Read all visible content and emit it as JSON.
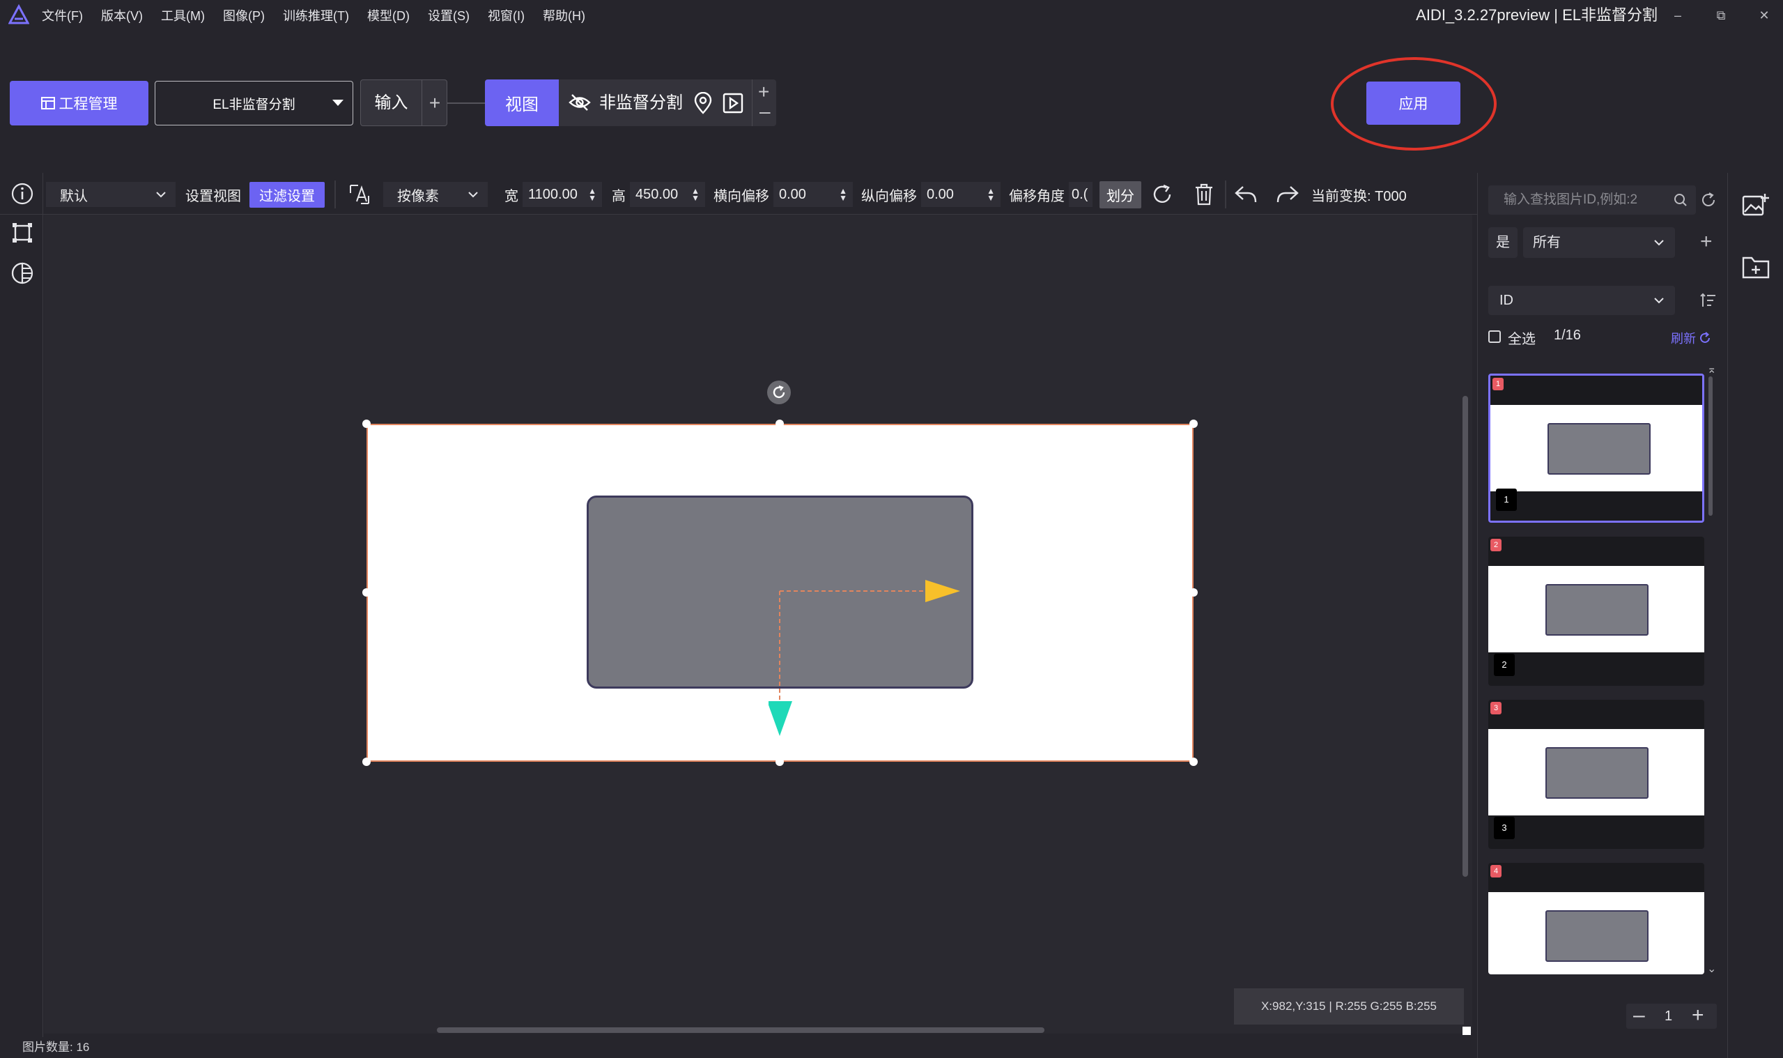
{
  "menu": [
    "文件(F)",
    "版本(V)",
    "工具(M)",
    "图像(P)",
    "训练推理(T)",
    "模型(D)",
    "设置(S)",
    "视窗(I)",
    "帮助(H)"
  ],
  "app_title": "AIDI_3.2.27preview | EL非监督分割",
  "window_controls": {
    "minimize": "–",
    "restore": "⧉",
    "close": "✕"
  },
  "toolbar": {
    "project_mgmt": "工程管理",
    "project_select": "EL非监督分割",
    "input": "输入",
    "add": "+",
    "view": "视图",
    "module": "非监督分割",
    "apply": "应用"
  },
  "view_toolbar": {
    "view_select": "默认",
    "set_view": "设置视图",
    "filter_settings": "过滤设置",
    "unit_select": "按像素",
    "width_label": "宽",
    "width_value": "1100.00",
    "height_label": "高",
    "height_value": "450.00",
    "h_offset_label": "横向偏移",
    "h_offset_value": "0.00",
    "v_offset_label": "纵向偏移",
    "v_offset_value": "0.00",
    "angle_label": "偏移角度",
    "angle_value": "0.(",
    "split": "划分",
    "current_transform": "当前变换: T000"
  },
  "right_panel": {
    "search_placeholder": "输入查找图片ID,例如:2",
    "filter_yes": "是",
    "filter_all": "所有",
    "sort_field": "ID",
    "select_all": "全选",
    "count": "1/16",
    "refresh": "刷新",
    "thumbnails": [
      {
        "red": "1",
        "black": "1"
      },
      {
        "red": "2",
        "black": "2"
      },
      {
        "red": "3",
        "black": "3"
      },
      {
        "red": "4",
        "black": ""
      }
    ],
    "page": "1"
  },
  "pixel_info": "X:982,Y:315 | R:255 G:255 B:255",
  "status": {
    "image_count": "图片数量:  16"
  },
  "icons": {
    "logo": "aidi-logo-icon",
    "info": "info-icon",
    "crop": "crop-icon",
    "contrast": "contrast-icon",
    "text_tool": "text-tool-icon",
    "rotate": "rotate-icon",
    "delete": "trash-icon",
    "undo": "undo-icon",
    "redo": "redo-icon",
    "add_image": "add-image-icon",
    "add_folder": "add-folder-icon"
  },
  "colors": {
    "accent": "#6c63f2",
    "background": "#26252c",
    "annotation_red": "#e0342a",
    "arrow_yellow": "#f8c02a",
    "arrow_cyan": "#1ed9b8"
  }
}
